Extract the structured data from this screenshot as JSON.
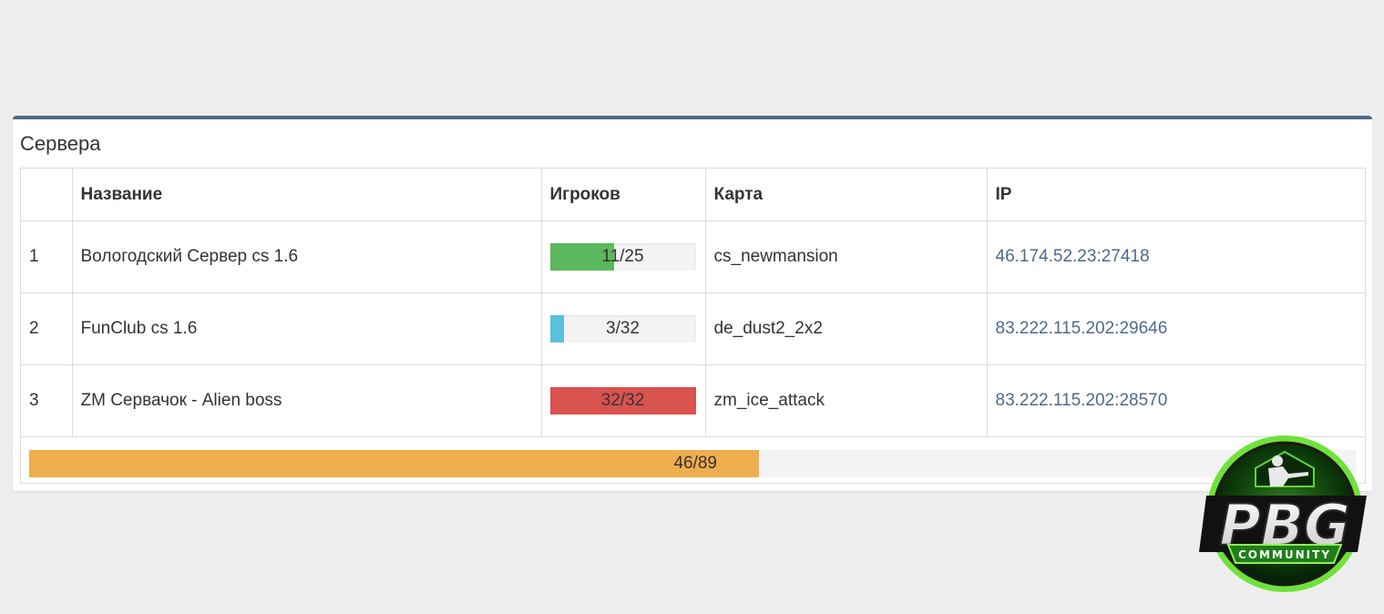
{
  "panel": {
    "title": "Сервера"
  },
  "table": {
    "headers": [
      "",
      "Название",
      "Игроков",
      "Карта",
      "IP"
    ],
    "rows": [
      {
        "num": "1",
        "name": "Вологодский Сервер cs 1.6",
        "players": "11/25",
        "fill": 0.44,
        "color": "#5cb85c",
        "map": "cs_newmansion",
        "ip": "46.174.52.23:27418"
      },
      {
        "num": "2",
        "name": "FunClub cs 1.6",
        "players": "3/32",
        "fill": 0.094,
        "color": "#5bc0de",
        "map": "de_dust2_2x2",
        "ip": "83.222.115.202:29646"
      },
      {
        "num": "3",
        "name": "ZM Сервачок - Alien boss",
        "players": "32/32",
        "fill": 1.0,
        "color": "#d9534f",
        "map": "zm_ice_attack",
        "ip": "83.222.115.202:28570"
      }
    ]
  },
  "total": {
    "label": "46/89",
    "fill": 0.55,
    "color": "#f0ad4e"
  },
  "logo": {
    "text": "PBG",
    "subtext": "COMMUNITY",
    "icon": "soldier-icon"
  }
}
